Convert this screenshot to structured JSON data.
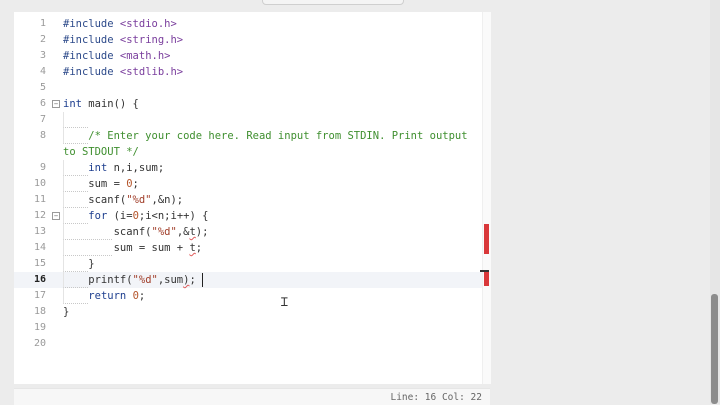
{
  "editor": {
    "lines": [
      {
        "n": "1",
        "parts": [
          [
            "pre",
            "#include "
          ],
          [
            "inc",
            "<stdio.h>"
          ]
        ]
      },
      {
        "n": "2",
        "parts": [
          [
            "pre",
            "#include "
          ],
          [
            "inc",
            "<string.h>"
          ]
        ]
      },
      {
        "n": "3",
        "parts": [
          [
            "pre",
            "#include "
          ],
          [
            "inc",
            "<math.h>"
          ]
        ]
      },
      {
        "n": "4",
        "parts": [
          [
            "pre",
            "#include "
          ],
          [
            "inc",
            "<stdlib.h>"
          ]
        ]
      },
      {
        "n": "5",
        "parts": []
      },
      {
        "n": "6",
        "fold": true,
        "parts": [
          [
            "kw",
            "int "
          ],
          [
            "txt",
            "main() {"
          ]
        ]
      },
      {
        "n": "7",
        "guides": 1,
        "parts": []
      },
      {
        "n": "8",
        "guides": 1,
        "parts": [
          [
            "cm",
            "    /* Enter your code here. Read input from STDIN. Print output"
          ]
        ]
      },
      {
        "n": "",
        "parts": [
          [
            "cm",
            "to STDOUT */"
          ]
        ]
      },
      {
        "n": "9",
        "guides": 1,
        "parts": [
          [
            "txt",
            "    "
          ],
          [
            "kw",
            "int "
          ],
          [
            "txt",
            "n,i,sum;"
          ]
        ]
      },
      {
        "n": "10",
        "guides": 1,
        "parts": [
          [
            "txt",
            "    sum = "
          ],
          [
            "num",
            "0"
          ],
          [
            "txt",
            ";"
          ]
        ]
      },
      {
        "n": "11",
        "guides": 1,
        "parts": [
          [
            "txt",
            "    scanf("
          ],
          [
            "str",
            "\"%d\""
          ],
          [
            "txt",
            ",&n);"
          ]
        ]
      },
      {
        "n": "12",
        "guides": 1,
        "fold": true,
        "parts": [
          [
            "txt",
            "    "
          ],
          [
            "kw",
            "for "
          ],
          [
            "txt",
            "(i="
          ],
          [
            "num",
            "0"
          ],
          [
            "txt",
            ";i<n;i++) {"
          ]
        ]
      },
      {
        "n": "13",
        "guides": 2,
        "parts": [
          [
            "txt",
            "        scanf("
          ],
          [
            "str",
            "\"%d\""
          ],
          [
            "txt",
            ",&"
          ],
          [
            "sq",
            "t"
          ],
          [
            "txt",
            ");"
          ]
        ]
      },
      {
        "n": "14",
        "guides": 2,
        "parts": [
          [
            "txt",
            "        sum = sum + "
          ],
          [
            "sq",
            "t"
          ],
          [
            "txt",
            ";"
          ]
        ]
      },
      {
        "n": "15",
        "guides": 1,
        "parts": [
          [
            "txt",
            "    }"
          ]
        ]
      },
      {
        "n": "16",
        "guides": 1,
        "active": true,
        "parts": [
          [
            "txt",
            "    printf("
          ],
          [
            "str",
            "\"%d\""
          ],
          [
            "txt",
            ",sum"
          ],
          [
            "sq",
            ")"
          ],
          [
            "txt",
            ";"
          ]
        ]
      },
      {
        "n": "17",
        "guides": 1,
        "parts": [
          [
            "txt",
            "    "
          ],
          [
            "kw",
            "return "
          ],
          [
            "num",
            "0"
          ],
          [
            "txt",
            ";"
          ]
        ]
      },
      {
        "n": "18",
        "parts": [
          [
            "txt",
            "}"
          ]
        ]
      },
      {
        "n": "19",
        "parts": []
      },
      {
        "n": "20",
        "parts": []
      }
    ]
  },
  "status": {
    "position": "Line: 16 Col: 22"
  },
  "colors": {
    "error_marker": "#d9383a",
    "comment": "#3f8f2f",
    "keyword": "#1e3f8f"
  }
}
